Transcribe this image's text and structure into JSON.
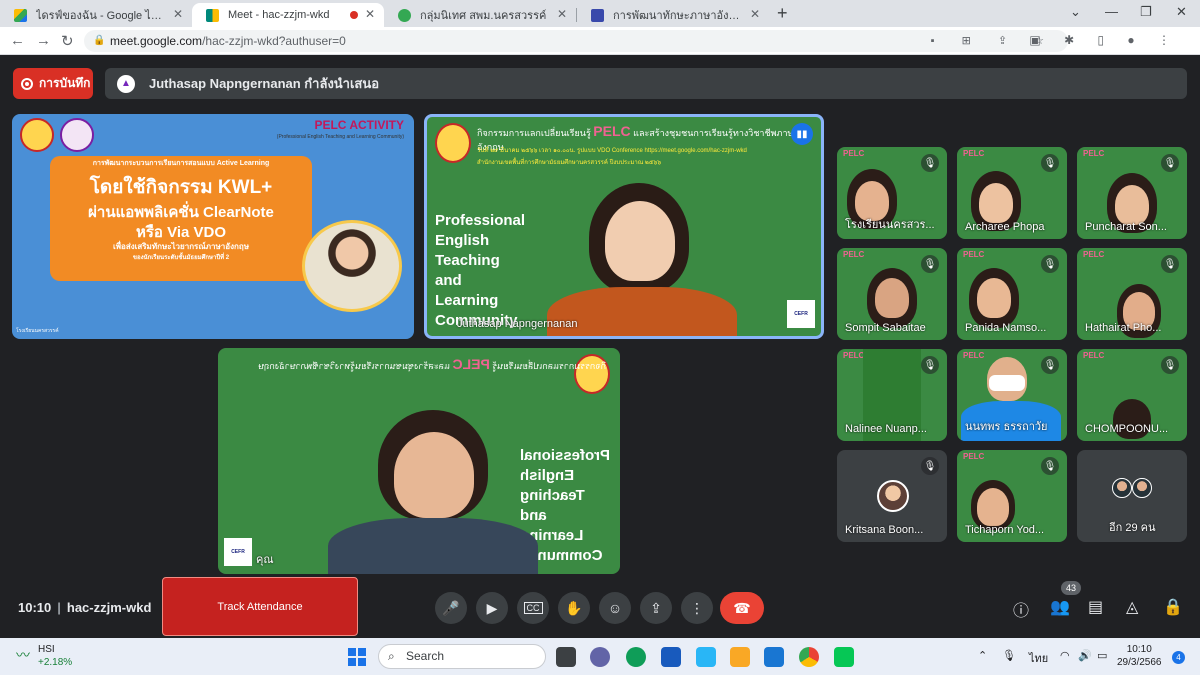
{
  "browser": {
    "tabs": [
      {
        "label": "ไดรฟ์ของฉัน - Google ไดรฟ์",
        "color": "#fbbc04"
      },
      {
        "label": "Meet - hac-zzjm-wkd",
        "color": "#00897b"
      },
      {
        "label": "กลุ่มนิเทศ สพม.นครสวรรค์",
        "color": "#34a853"
      },
      {
        "label": "การพัฒนาทักษะภาษาอังกฤษ English",
        "color": "#3949ab"
      }
    ],
    "new_tab": "+",
    "url_host": "meet.google.com",
    "url_path": "/hac-zzjm-wkd?authuser=0"
  },
  "meet": {
    "record_label": "การบันทึก",
    "presenting_text": "Juthasap Napngernanan กำลังนำเสนอ",
    "slide": {
      "pelc": "PELC ACTIVITY",
      "pelc_sub": "(Professional English Teaching and Learning Community)",
      "line1": "การพัฒนากระบวนการเรียนการสอนแบบ Active Learning",
      "line2": "โดยใช้กิจกรรม KWL+",
      "line3": "ผ่านแอพพลิเคชั่น ClearNote",
      "line4": "หรือ Via VDO",
      "line5": "เพื่อส่งเสริมทักษะไวยากรณ์ภาษาอังกฤษ",
      "line6": "ของนักเรียนระดับชั้นมัธยมศึกษาปีที่ 2",
      "footer": "โรงเรียนนครสวรรค์"
    },
    "presenter": {
      "header": "กิจกรรมการแลกเปลี่ยนเรียนรู้",
      "header_pelc": "PELC",
      "header_tail": "และสร้างชุมชนการเรียนรู้ทางวิชาชีพภาษาอังกฤษ",
      "sub1": "วันที่ ๒๙ มีนาคม ๒๕๖๖ เวลา ๑๐.๐๐น. รูปแบบ VDO Conference https://meet.google.com/hac-zzjm-wkd",
      "sub2": "สำนักงานเขตพื้นที่การศึกษามัธยมศึกษานครสวรรค์ ปีงบประมาณ ๒๕๖๖",
      "big_text": [
        "Professional",
        "English",
        "Teaching",
        "and",
        "Learning",
        "Community"
      ],
      "name": "Juthasap Napngernanan",
      "cefr": "CEFR"
    },
    "bottom_tile": {
      "name": "คุณ",
      "cefr": "CEFR"
    },
    "participants": [
      {
        "name": "โรงเรียนนครสวร..."
      },
      {
        "name": "Archaree Phopa"
      },
      {
        "name": "Puncharat Son..."
      },
      {
        "name": "Sompit Sabaitae"
      },
      {
        "name": "Panida Namso..."
      },
      {
        "name": "Hathairat Pho..."
      },
      {
        "name": "Nalinee Nuanp..."
      },
      {
        "name": "นนทพร ธรรถาวัย"
      },
      {
        "name": "CHOMPOONU..."
      },
      {
        "name": "Kritsana Boon..."
      },
      {
        "name": "Tichaporn Yod..."
      }
    ],
    "more_label": "อีก 29 คน",
    "pelc_tag": "PELC"
  },
  "controls": {
    "time": "10:10",
    "meeting_code": "hac-zzjm-wkd",
    "track_attendance": "Track Attendance",
    "people_count": "43"
  },
  "taskbar": {
    "ticker_name": "HSI",
    "ticker_change": "+2.18%",
    "search_placeholder": "Search",
    "lang": "ไทย",
    "clock_time": "10:10",
    "clock_date": "29/3/2566",
    "notif_count": "4"
  },
  "colors": {
    "meet_bg": "#202124",
    "tile_green": "#3b8a43",
    "record_red": "#d93025",
    "hangup_red": "#ea4335",
    "accent_blue": "#8ab4f8"
  }
}
